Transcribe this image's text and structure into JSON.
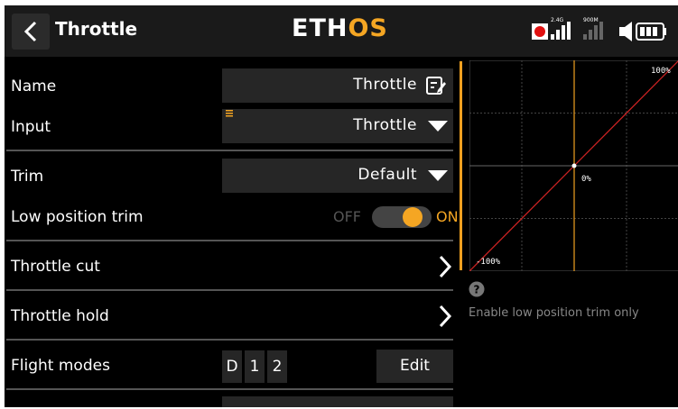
{
  "header": {
    "title": "Throttle",
    "logo_part1": "ETH",
    "logo_part2": "OS",
    "signal_label_1": "2.4G",
    "signal_label_2": "900M"
  },
  "rows": {
    "name_label": "Name",
    "name_value": "Throttle",
    "input_label": "Input",
    "input_value": "Throttle",
    "trim_label": "Trim",
    "trim_value": "Default",
    "low_trim_label": "Low position trim",
    "low_trim_off": "OFF",
    "low_trim_on": "ON",
    "low_trim_enabled": true,
    "throttle_cut_label": "Throttle cut",
    "throttle_hold_label": "Throttle hold",
    "flight_modes_label": "Flight modes",
    "flight_modes": [
      "D",
      "1",
      "2"
    ],
    "edit_label": "Edit"
  },
  "graph": {
    "label_top": "100%",
    "label_mid": "0%",
    "label_bottom": "-100%",
    "x_range": [
      -100,
      100
    ],
    "y_range": [
      -100,
      100
    ],
    "curve": [
      [
        -100,
        -100
      ],
      [
        100,
        100
      ]
    ],
    "current_input": 0,
    "curve_color": "#cc2222",
    "cursor_color": "#f0a020"
  },
  "help": {
    "text": "Enable low position trim only"
  },
  "colors": {
    "accent": "#f5a623",
    "background": "#000000",
    "field": "#262626"
  }
}
